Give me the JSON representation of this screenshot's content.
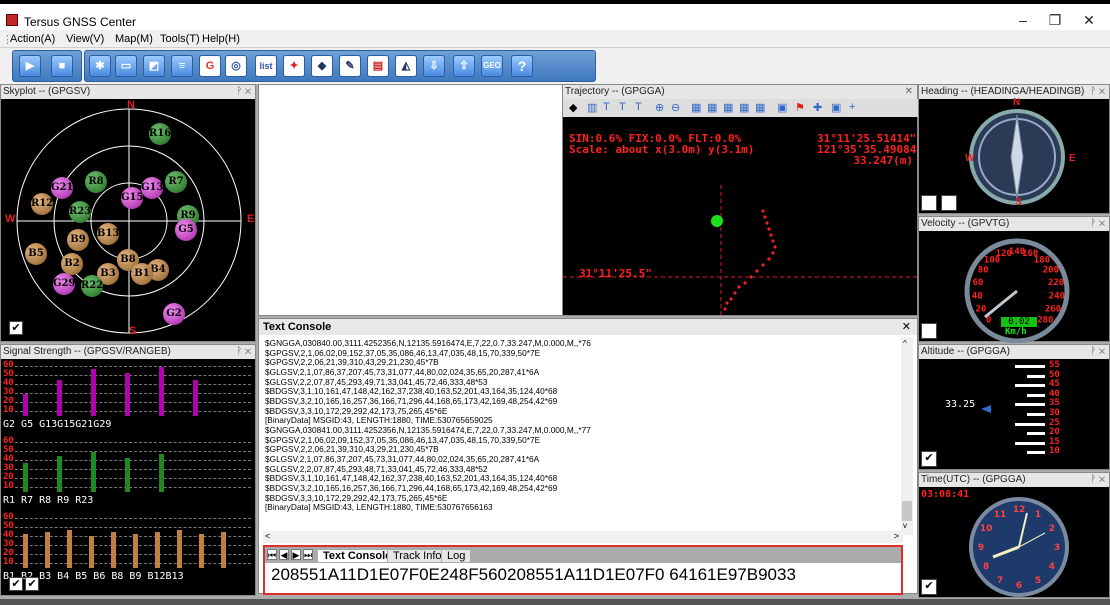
{
  "window": {
    "title": "Tersus GNSS Center"
  },
  "menu": [
    "Action(A)",
    "View(V)",
    "Map(M)",
    "Tools(T)",
    "Help(H)"
  ],
  "toolbar": {
    "groups": [
      [
        "play-icon",
        "stop-icon"
      ],
      [
        "gear-icon",
        "device-icon",
        "monitor-icon",
        "list-icon",
        "google-icon",
        "signal-icon",
        "list-text-icon",
        "pin-icon",
        "marker-icon",
        "edit-icon",
        "pdf-icon",
        "chart-icon",
        "import-icon",
        "export-icon"
      ]
    ],
    "geo_label": "GEO",
    "help_label": "?",
    "list_label": "list"
  },
  "panels": {
    "skyplot": {
      "title": "Skyplot -- (GPGSV)",
      "north": "N",
      "south": "S",
      "east": "E",
      "west": "W",
      "sats": [
        {
          "id": "R16",
          "c": "g"
        },
        {
          "id": "R8",
          "c": "g"
        },
        {
          "id": "R7",
          "c": "g"
        },
        {
          "id": "G21",
          "c": "m"
        },
        {
          "id": "G15",
          "c": "m"
        },
        {
          "id": "G13",
          "c": "m"
        },
        {
          "id": "R12",
          "c": "b"
        },
        {
          "id": "R23",
          "c": "g"
        },
        {
          "id": "B13",
          "c": "b"
        },
        {
          "id": "R9",
          "c": "g"
        },
        {
          "id": "G5",
          "c": "m"
        },
        {
          "id": "B5",
          "c": "b"
        },
        {
          "id": "B9",
          "c": "b"
        },
        {
          "id": "B8",
          "c": "b"
        },
        {
          "id": "B2",
          "c": "b"
        },
        {
          "id": "B4",
          "c": "b"
        },
        {
          "id": "B3",
          "c": "b"
        },
        {
          "id": "B1",
          "c": "b"
        },
        {
          "id": "G29",
          "c": "m"
        },
        {
          "id": "R22",
          "c": "g"
        },
        {
          "id": "G2",
          "c": "m"
        }
      ]
    },
    "signal": {
      "title": "Signal Strength -- (GPGSV/RANGEB)",
      "scale": [
        "60",
        "50",
        "40",
        "30",
        "20",
        "10"
      ],
      "gps": {
        "labels": "G2 G5 G13G15G21G29",
        "values": [
          25,
          40,
          52,
          48,
          55,
          40
        ]
      },
      "glo": {
        "labels": "R1 R7 R8 R9 R23",
        "values": [
          32,
          40,
          44,
          38,
          42
        ]
      },
      "bds": {
        "labels": "B1 B2 B3 B4 B5 B6 B8 B9 B12B13",
        "values": [
          38,
          40,
          42,
          36,
          40,
          38,
          40,
          42,
          38,
          40
        ]
      }
    },
    "trajectory": {
      "title": "Trajectory -- (GPGGA)",
      "line1": "SIN:0.6% FIX:0.0% FLT:0.0%",
      "line2": "Scale: about x(3.0m) y(3.1m)",
      "lat": "31°11'25.51414\"",
      "lon": "121°35'35.49084\"",
      "alt": "33.247(m)",
      "axis": "31°11'25.5\""
    },
    "heading": {
      "title": "Heading -- (HEADINGA/HEADINGB)",
      "n": "N",
      "s": "S",
      "e": "E",
      "w": "W"
    },
    "velocity": {
      "title": "Velocity -- (GPVTG)",
      "value": "0.02",
      "unit": "Km/h",
      "ticks": [
        "0",
        "20",
        "40",
        "60",
        "80",
        "100",
        "120",
        "140",
        "160",
        "180",
        "200",
        "220",
        "240",
        "260",
        "280"
      ]
    },
    "altitude": {
      "title": "Altitude -- (GPGGA)",
      "value": "33.25",
      "ticks": [
        "55",
        "50",
        "45",
        "40",
        "35",
        "30",
        "25",
        "20",
        "15",
        "10"
      ]
    },
    "time": {
      "title": "Time(UTC) -- (GPGGA)",
      "value": "03:08:41",
      "numbers": [
        "12",
        "1",
        "2",
        "3",
        "4",
        "5",
        "6",
        "7",
        "8",
        "9",
        "10",
        "11"
      ]
    }
  },
  "console": {
    "title": "Text Console",
    "lines": [
      "$GNGGA,030840.00,3111.4252356,N,12135.5916474,E,7,22,0.7,33.247,M,0.000,M,,*76",
      "$GPGSV,2,1,06,02,09,152,37,05,35,086,46,13,47,035,48,15,70,339,50*7E",
      "$GPGSV,2,2,06,21,39,310,43,29,21,230,45*7B",
      "$GLGSV,2,1,07,86,37,207,45,73,31,077,44,80,02,024,35,65,20,287,41*6A",
      "$GLGSV,2,2,07,87,45,293,49,71,33,041,45,72,46,333,48*53",
      "$BDGSV,3,1,10,161,47,148,42,162,37,238,40,163,52,201,43,164,35,124,40*68",
      "$BDGSV,3,2,10,165,16,257,36,166,71,296,44,168,65,173,42,169,48,254,42*69",
      "$BDGSV,3,3,10,172,29,292,42,173,75,265,45*6E",
      "[BinaryData] MSGID:43, LENGTH:1880, TIME:530765659025",
      "$GNGGA,030841.00,3111.4252356,N,12135.5916474,E,7,22,0.7,33.247,M,0.000,M,,*77",
      "$GPGSV,2,1,06,02,09,152,37,05,35,086,46,13,47,035,48,15,70,339,50*7E",
      "$GPGSV,2,2,06,21,39,310,43,29,21,230,45*7B",
      "$GLGSV,2,1,07,86,37,207,45,73,31,077,44,80,02,024,35,65,20,287,41*6A",
      "$GLGSV,2,2,07,87,45,293,48,71,33,041,45,72,46,333,48*52",
      "$BDGSV,3,1,10,161,47,148,42,162,37,238,40,163,52,201,43,164,35,124,40*68",
      "$BDGSV,3,2,10,165,16,257,36,166,71,296,44,168,65,173,42,169,48,254,42*69",
      "$BDGSV,3,3,10,172,29,292,42,173,75,265,45*6E",
      "[BinaryData] MSGID:43, LENGTH:1880, TIME:530767656163"
    ],
    "tabs": [
      "Text Console",
      "Track Info",
      "Log"
    ],
    "command": "208551A11D1E07F0E248F560208551A11D1E07F0 64161E97B9033"
  },
  "colors": {
    "gps": "#b000b0",
    "glo": "#1e8a1e",
    "bds": "#c08040",
    "accent": "#2a6fd0"
  }
}
